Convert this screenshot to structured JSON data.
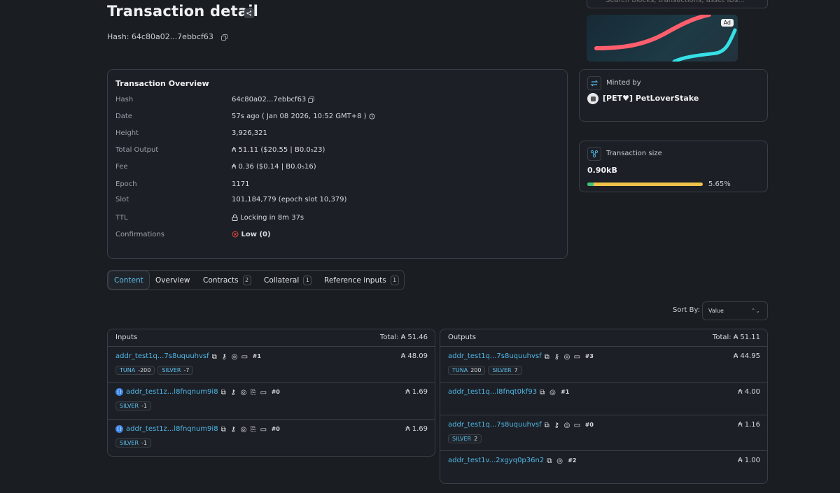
{
  "header": {
    "title": "Transaction detail",
    "hash_label": "Hash: 64c80a02...7ebbcf63"
  },
  "search": {
    "placeholder": "Search blocks, transactions, asset IDs..."
  },
  "ad": {
    "badge": "Ad"
  },
  "overview": {
    "title": "Transaction Overview",
    "rows": [
      {
        "key": "Hash",
        "value": "64c80a02...7ebbcf63"
      },
      {
        "key": "Date",
        "value": "57s ago ( Jan 08 2026, 10:52 GMT+8 )"
      },
      {
        "key": "Height",
        "value": "3,926,321"
      },
      {
        "key": "Total Output",
        "value": "₳ 51.11 ($20.55 | B0.0₅23)"
      },
      {
        "key": "Fee",
        "value": "₳ 0.36 ($0.14 | B0.0₅16)"
      },
      {
        "key": "Epoch",
        "value": "1171"
      },
      {
        "key": "Slot",
        "value": "101,184,779 (epoch slot 10,379)"
      },
      {
        "key": "TTL",
        "value": "Locking in 8m 37s"
      },
      {
        "key": "Confirmations",
        "value": "Low (0)"
      }
    ]
  },
  "minted": {
    "label": "Minted by",
    "name": "[PET♥] PetLoverStake"
  },
  "size": {
    "label": "Transaction size",
    "value": "0.90kB",
    "percent_label": "5.65%",
    "fill_percent": 100
  },
  "tabs": [
    {
      "label": "Content"
    },
    {
      "label": "Overview"
    },
    {
      "label": "Contracts",
      "count": "2"
    },
    {
      "label": "Collateral",
      "count": "1"
    },
    {
      "label": "Reference inputs",
      "count": "1"
    }
  ],
  "sort": {
    "label": "Sort By:",
    "value": "Value"
  },
  "inputs": {
    "title": "Inputs",
    "total": "Total: ₳ 51.46",
    "rows": [
      {
        "addr": "addr_test1q...7s8uquuhvsf",
        "idx": "#1",
        "amount": "₳ 48.09",
        "chips": [
          {
            "name": "TUNA",
            "qty": "-200"
          },
          {
            "name": "SILVER",
            "qty": "-7"
          }
        ]
      },
      {
        "addr": "addr_test1z...l8fnqnum9i8",
        "idx": "#0",
        "amount": "₳ 1.69",
        "chips": [
          {
            "name": "SILVER",
            "qty": "-1"
          }
        ]
      },
      {
        "addr": "addr_test1z...l8fnqnum9i8",
        "idx": "#0",
        "amount": "₳ 1.69",
        "chips": [
          {
            "name": "SILVER",
            "qty": "-1"
          }
        ]
      }
    ]
  },
  "outputs": {
    "title": "Outputs",
    "total": "Total: ₳ 51.11",
    "rows": [
      {
        "addr": "addr_test1q...7s8uquuhvsf",
        "idx": "#3",
        "amount": "₳ 44.95",
        "chips": [
          {
            "name": "TUNA",
            "qty": "200"
          },
          {
            "name": "SILVER",
            "qty": "7"
          }
        ]
      },
      {
        "addr": "addr_test1q...l8fnqt0kf93",
        "idx": "#1",
        "amount": "₳ 4.00",
        "chips": []
      },
      {
        "addr": "addr_test1q...7s8uquuhvsf",
        "idx": "#0",
        "amount": "₳ 1.16",
        "chips": [
          {
            "name": "SILVER",
            "qty": "2"
          }
        ]
      },
      {
        "addr": "addr_test1v...2xgyq0p36n2",
        "idx": "#2",
        "amount": "₳ 1.00",
        "chips": []
      }
    ]
  },
  "colors": {
    "background": "#1a1d22",
    "link": "#4fb6e6",
    "danger": "#e0483e",
    "progress": "#f0c24a"
  }
}
